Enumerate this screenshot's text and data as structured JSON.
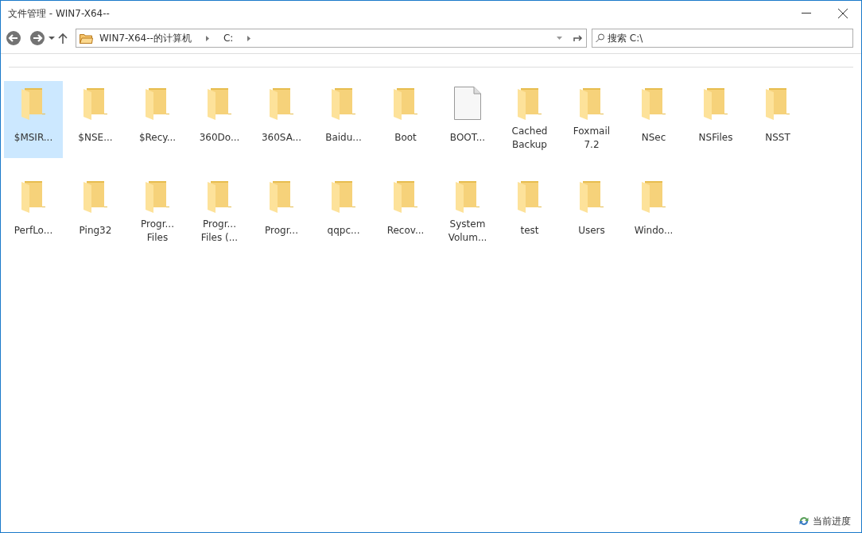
{
  "window": {
    "title": "文件管理 - WIN7-X64--"
  },
  "address_bar": {
    "crumbs": [
      "WIN7-X64--的计算机",
      "C:"
    ]
  },
  "search": {
    "placeholder": "搜索 C:\\"
  },
  "items": [
    {
      "kind": "folder",
      "lines": [
        "$MSIR..."
      ],
      "selected": true
    },
    {
      "kind": "folder",
      "lines": [
        "$NSE..."
      ],
      "selected": false
    },
    {
      "kind": "folder",
      "lines": [
        "$Recy..."
      ],
      "selected": false
    },
    {
      "kind": "folder",
      "lines": [
        "360Do..."
      ],
      "selected": false
    },
    {
      "kind": "folder",
      "lines": [
        "360SA..."
      ],
      "selected": false
    },
    {
      "kind": "folder",
      "lines": [
        "Baidu..."
      ],
      "selected": false
    },
    {
      "kind": "folder",
      "lines": [
        "Boot"
      ],
      "selected": false
    },
    {
      "kind": "file",
      "lines": [
        "BOOT..."
      ],
      "selected": false
    },
    {
      "kind": "folder",
      "lines": [
        "Cached",
        "Backup"
      ],
      "selected": false
    },
    {
      "kind": "folder",
      "lines": [
        "Foxmail",
        "7.2"
      ],
      "selected": false
    },
    {
      "kind": "folder",
      "lines": [
        "NSec"
      ],
      "selected": false
    },
    {
      "kind": "folder",
      "lines": [
        "NSFiles"
      ],
      "selected": false
    },
    {
      "kind": "folder",
      "lines": [
        "NSST"
      ],
      "selected": false
    },
    {
      "kind": "folder",
      "lines": [
        "PerfLo..."
      ],
      "selected": false
    },
    {
      "kind": "folder",
      "lines": [
        "Ping32"
      ],
      "selected": false
    },
    {
      "kind": "folder",
      "lines": [
        "Progr...",
        "Files"
      ],
      "selected": false
    },
    {
      "kind": "folder",
      "lines": [
        "Progr...",
        "Files (..."
      ],
      "selected": false
    },
    {
      "kind": "folder",
      "lines": [
        "Progr..."
      ],
      "selected": false
    },
    {
      "kind": "folder",
      "lines": [
        "qqpc..."
      ],
      "selected": false
    },
    {
      "kind": "folder",
      "lines": [
        "Recov..."
      ],
      "selected": false
    },
    {
      "kind": "folder",
      "lines": [
        "System",
        "Volum..."
      ],
      "selected": false
    },
    {
      "kind": "folder",
      "lines": [
        "test"
      ],
      "selected": false
    },
    {
      "kind": "folder",
      "lines": [
        "Users"
      ],
      "selected": false
    },
    {
      "kind": "folder",
      "lines": [
        "Windo..."
      ],
      "selected": false
    }
  ],
  "status_bar": {
    "progress_label": "当前进度"
  }
}
